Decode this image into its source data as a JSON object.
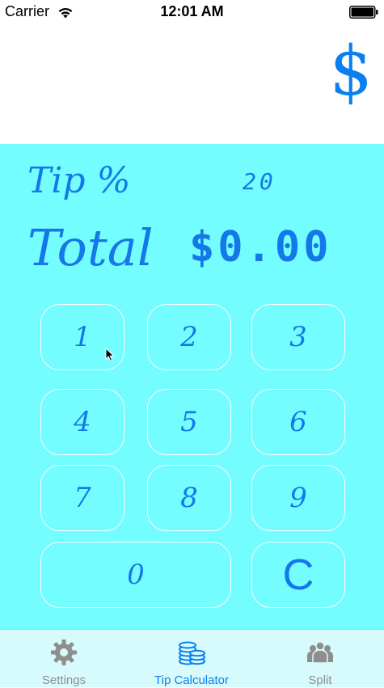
{
  "status_bar": {
    "carrier": "Carrier",
    "time": "12:01 AM"
  },
  "header": {
    "logo_symbol": "$"
  },
  "calculator": {
    "tip_label": "Tip %",
    "tip_value": "20",
    "total_label": "Total",
    "total_value": "$0.00",
    "keys": {
      "k1": "1",
      "k2": "2",
      "k3": "3",
      "k4": "4",
      "k5": "5",
      "k6": "6",
      "k7": "7",
      "k8": "8",
      "k9": "9",
      "k0": "0",
      "clear": "C"
    }
  },
  "tab_bar": {
    "tabs": [
      {
        "label": "Settings",
        "icon": "gear-icon"
      },
      {
        "label": "Tip Calculator",
        "icon": "coins-icon",
        "selected": true
      },
      {
        "label": "Split",
        "icon": "people-icon"
      }
    ]
  },
  "colors": {
    "accent": "#1478e8",
    "panel_background": "#74fdff",
    "tab_bar_background": "#d7fbfc",
    "tab_inactive": "#8e8e8e",
    "tab_active": "#0a7ff0"
  }
}
